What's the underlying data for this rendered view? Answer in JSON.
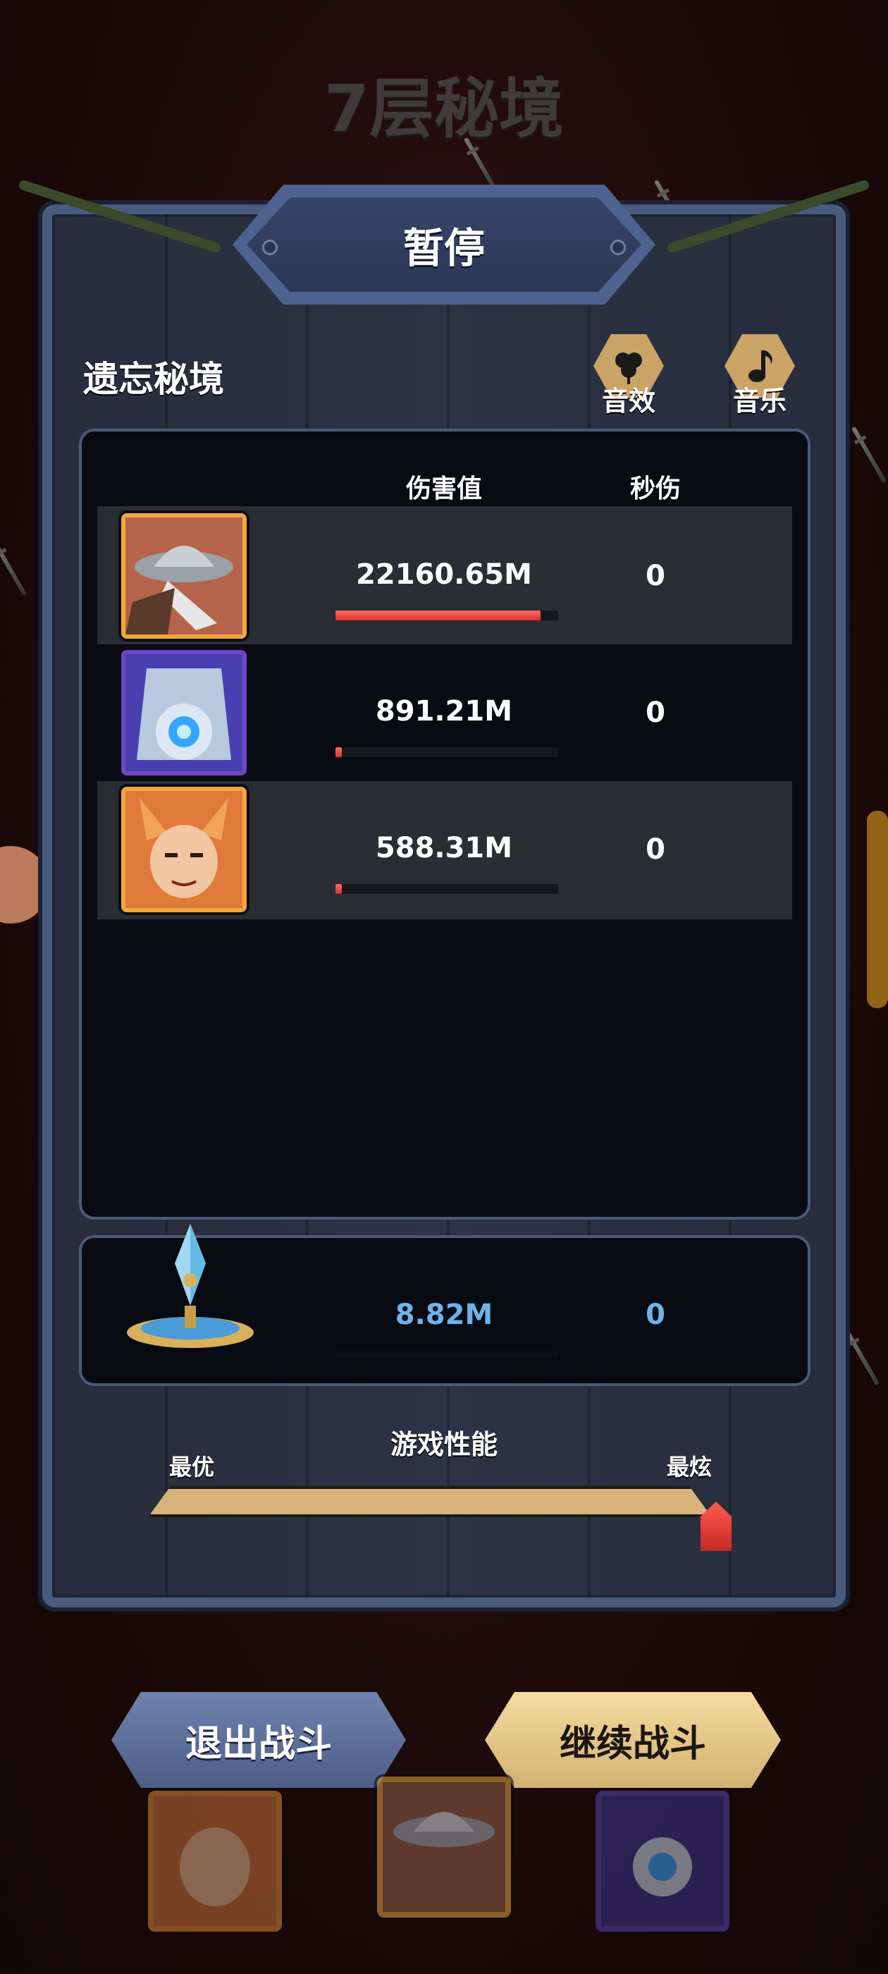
{
  "floor_title": "7层秘境",
  "dialog_title": "暂停",
  "realm_name": "遗忘秘境",
  "settings": {
    "sound_label": "音效",
    "music_label": "音乐",
    "sound_icon": "clover-icon",
    "music_icon": "music-note-icon"
  },
  "table": {
    "headers": {
      "damage": "伤害值",
      "dps": "秒伤"
    },
    "rows": [
      {
        "hero": "hat-wizard",
        "frame": "orange",
        "damage": "22160.65M",
        "dps": "0",
        "bar_fraction": 0.92
      },
      {
        "hero": "crystal-knight",
        "frame": "purple",
        "damage": "891.21M",
        "dps": "0",
        "bar_fraction": 0.03
      },
      {
        "hero": "fox-warrior",
        "frame": "orange",
        "damage": "588.31M",
        "dps": "0",
        "bar_fraction": 0.02
      }
    ]
  },
  "summon": {
    "icon": "crystal-totem-icon",
    "damage": "8.82M",
    "dps": "0"
  },
  "performance": {
    "title": "游戏性能",
    "min_label": "最优",
    "max_label": "最炫",
    "level": 1.0
  },
  "buttons": {
    "exit": "退出战斗",
    "continue": "继续战斗"
  },
  "colors": {
    "accent_gold": "#d8b47c",
    "panel_border": "#4a5b80",
    "damage_bar": "#e0403a",
    "summon_text": "#6fb3ea"
  }
}
